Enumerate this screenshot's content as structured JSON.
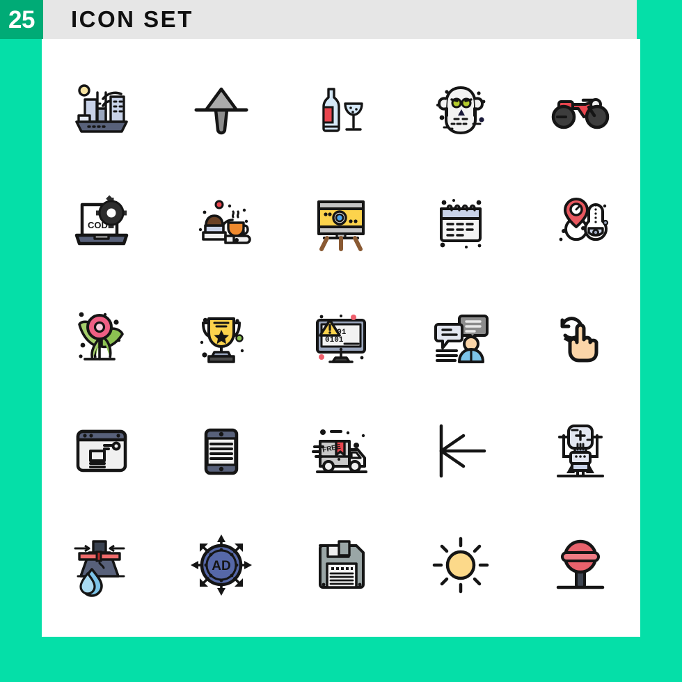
{
  "header": {
    "badge_count": "25",
    "title": "ICON SET",
    "badge_bg": "#00ab76",
    "bar_bg": "#e6e6e6",
    "page_bg": "#05dfa8",
    "panel_bg": "#ffffff"
  },
  "palette": {
    "stroke": "#151515",
    "light_blue": "#d5e8f7",
    "pale_blue": "#c8d2e8",
    "steel": "#9aa6bd",
    "slate": "#58617a",
    "red": "#e8454e",
    "yellow": "#fcd34c",
    "orange": "#f08a2e",
    "pink": "#ef5f84",
    "green": "#8cc152",
    "skin": "#fbd5a8",
    "grey": "#c8c8c8",
    "white": "#ffffff"
  },
  "grid": {
    "columns": 5,
    "rows": 5,
    "total": 25,
    "icons": [
      {
        "row": 1,
        "col": 1,
        "name": "smart-city-icon",
        "label": "Smart City"
      },
      {
        "row": 1,
        "col": 2,
        "name": "arrow-up-align-icon",
        "label": "Arrow Up"
      },
      {
        "row": 1,
        "col": 3,
        "name": "wine-bottle-glass-icon",
        "label": "Wine"
      },
      {
        "row": 1,
        "col": 4,
        "name": "ghost-zombie-icon",
        "label": "Ghost"
      },
      {
        "row": 1,
        "col": 5,
        "name": "motorbike-icon",
        "label": "Motorbike"
      },
      {
        "row": 2,
        "col": 1,
        "name": "laptop-code-gear-icon",
        "label": "Coding",
        "text": "CODE"
      },
      {
        "row": 2,
        "col": 2,
        "name": "espresso-portafilter-icon",
        "label": "Espresso"
      },
      {
        "row": 2,
        "col": 3,
        "name": "projector-screen-icon",
        "label": "Projector"
      },
      {
        "row": 2,
        "col": 4,
        "name": "spiral-calendar-icon",
        "label": "Calendar"
      },
      {
        "row": 2,
        "col": 5,
        "name": "thermometer-location-icon",
        "label": "Temperature"
      },
      {
        "row": 3,
        "col": 1,
        "name": "flower-icon",
        "label": "Flower"
      },
      {
        "row": 3,
        "col": 2,
        "name": "trophy-icon",
        "label": "Trophy"
      },
      {
        "row": 3,
        "col": 3,
        "name": "monitor-error-binary-icon",
        "label": "Error",
        "text": "0101"
      },
      {
        "row": 3,
        "col": 4,
        "name": "chat-user-icon",
        "label": "Chat"
      },
      {
        "row": 3,
        "col": 5,
        "name": "rotate-gesture-hand-icon",
        "label": "Rotate Gesture"
      },
      {
        "row": 4,
        "col": 1,
        "name": "browser-layout-icon",
        "label": "Web Layout"
      },
      {
        "row": 4,
        "col": 2,
        "name": "tablet-text-icon",
        "label": "Tablet"
      },
      {
        "row": 4,
        "col": 3,
        "name": "free-delivery-truck-icon",
        "label": "Free Delivery",
        "text": "FREE"
      },
      {
        "row": 4,
        "col": 4,
        "name": "arrow-to-left-icon",
        "label": "Align Left"
      },
      {
        "row": 4,
        "col": 5,
        "name": "robot-icon",
        "label": "Robot"
      },
      {
        "row": 5,
        "col": 1,
        "name": "water-drip-valve-icon",
        "label": "Water Drip"
      },
      {
        "row": 5,
        "col": 2,
        "name": "ad-target-icon",
        "label": "Ad Targeting",
        "text": "AD"
      },
      {
        "row": 5,
        "col": 3,
        "name": "floppy-disk-save-icon",
        "label": "Save"
      },
      {
        "row": 5,
        "col": 4,
        "name": "sun-brightness-icon",
        "label": "Sun"
      },
      {
        "row": 5,
        "col": 5,
        "name": "lollipop-icon",
        "label": "Lollipop"
      }
    ]
  }
}
